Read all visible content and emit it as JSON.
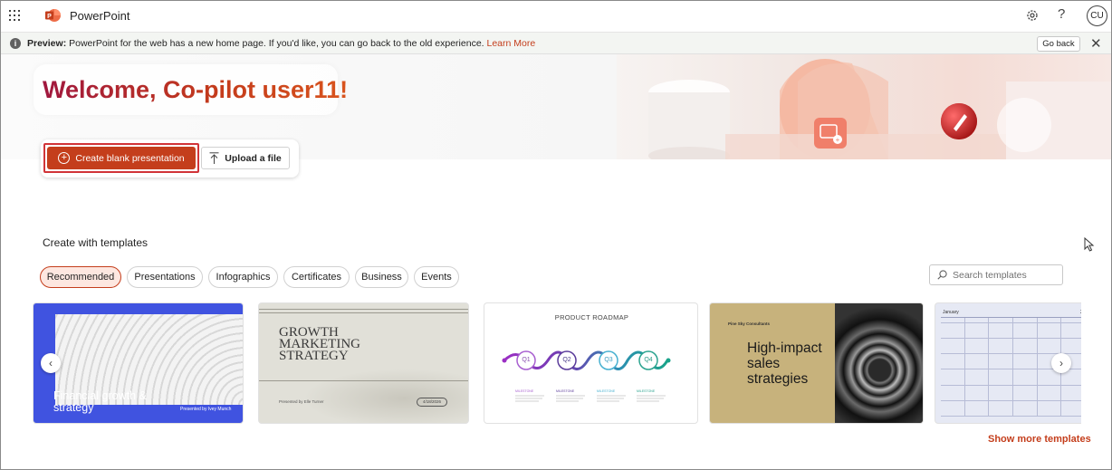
{
  "app": {
    "name": "PowerPoint"
  },
  "user": {
    "initials": "CU"
  },
  "icons": [
    "app-launcher-icon",
    "powerpoint-logo-icon",
    "settings-gear-icon",
    "help-icon",
    "info-icon",
    "close-icon",
    "plus-circle-icon",
    "upload-icon",
    "search-icon",
    "chevron-left-icon",
    "chevron-right-icon",
    "mouse-cursor-icon"
  ],
  "preview_bar": {
    "bold": "Preview:",
    "text": " PowerPoint for the web has a new home page. If you'd like, you can go back to the old experience. ",
    "link": "Learn More",
    "go_back": "Go back"
  },
  "hero": {
    "welcome": "Welcome, Co-pilot user11!",
    "create_blank": "Create blank presentation",
    "upload": "Upload a file"
  },
  "templates": {
    "heading": "Create with templates",
    "filters": [
      {
        "label": "Recommended",
        "active": true
      },
      {
        "label": "Presentations",
        "active": false
      },
      {
        "label": "Infographics",
        "active": false
      },
      {
        "label": "Certificates",
        "active": false
      },
      {
        "label": "Business",
        "active": false
      },
      {
        "label": "Events",
        "active": false
      }
    ],
    "search_placeholder": "Search templates",
    "cards": {
      "financial": {
        "title": "Financial growth & strategy",
        "subtitle": "Presented by Ivey Munch"
      },
      "marketing": {
        "title": "GROWTH MARKETING STRATEGY",
        "subtitle": "Presented by Elle Turner",
        "date": "4/18/2026"
      },
      "roadmap": {
        "title": "PRODUCT ROADMAP",
        "quarters": [
          "Q1",
          "Q2",
          "Q3",
          "Q4"
        ],
        "milestone_label": "MILESTONE"
      },
      "sales": {
        "title": "High-impact sales strategies",
        "subtitle": "Pine Sky Consultants"
      },
      "calendar": {
        "month": "January",
        "year": "2"
      }
    },
    "show_more": "Show more templates"
  },
  "colors": {
    "accent": "#c43e1c",
    "highlight_border": "#d13438",
    "card1_bg": "#4053e0",
    "card4_bg": "#c7b27c"
  }
}
